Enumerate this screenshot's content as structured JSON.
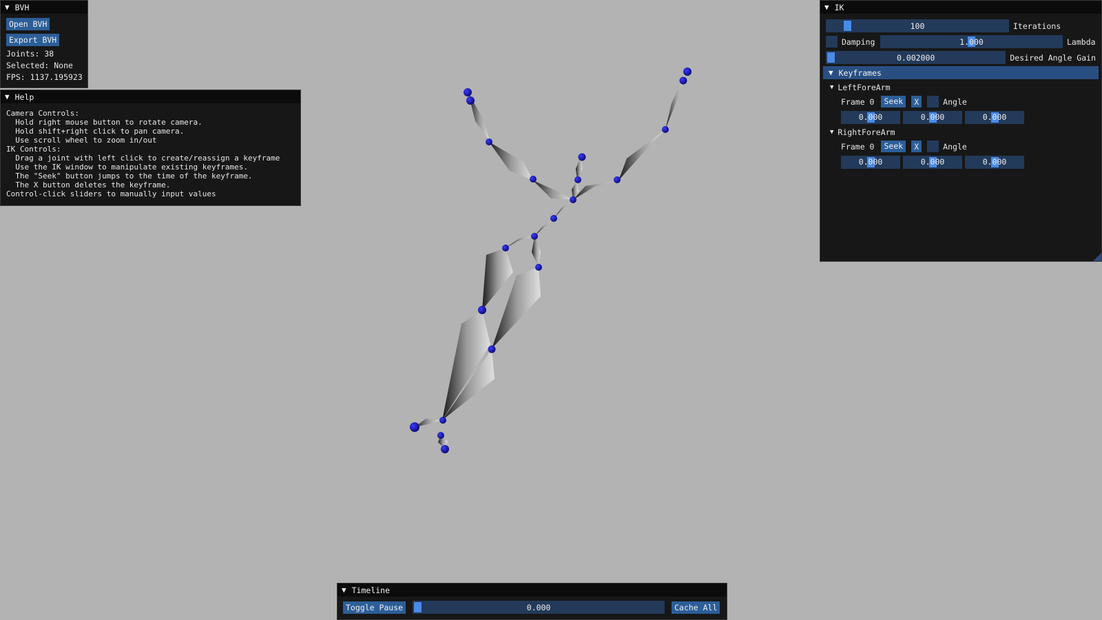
{
  "bvh_window": {
    "title": "BVH",
    "open_label": "Open BVH",
    "export_label": "Export BVH",
    "joints": "Joints: 38",
    "selected": "Selected: None",
    "fps": "FPS: 1137.195923"
  },
  "help_window": {
    "title": "Help",
    "lines": [
      "Camera Controls:",
      "  Hold right mouse button to rotate camera.",
      "  Hold shift+right click to pan camera.",
      "  Use scroll wheel to zoom in/out",
      "IK Controls:",
      "  Drag a joint with left click to create/reassign a keyframe",
      "  Use the IK window to manipulate existing keyframes.",
      "  The \"Seek\" button jumps to the time of the keyframe.",
      "  The X button deletes the keyframe.",
      "Control-click sliders to manually input values"
    ]
  },
  "ik_window": {
    "title": "IK",
    "iterations": {
      "value": "100",
      "label": "Iterations",
      "fraction": 0.1
    },
    "damping_label": "Damping",
    "lambda": {
      "value": "1.000",
      "label": "Lambda",
      "fraction": 0.5
    },
    "gain": {
      "value": "0.002000",
      "label": "Desired Angle Gain",
      "fraction": 0.0
    },
    "keyframes_header": "Keyframes",
    "keyframes": [
      {
        "joint": "LeftForeArm",
        "frame_label": "Frame 0",
        "seek_label": "Seek",
        "x_label": "X",
        "angle_label": "Angle",
        "values": [
          "0.000",
          "0.000",
          "0.000"
        ]
      },
      {
        "joint": "RightForeArm",
        "frame_label": "Frame 0",
        "seek_label": "Seek",
        "x_label": "X",
        "angle_label": "Angle",
        "values": [
          "0.000",
          "0.000",
          "0.000"
        ]
      }
    ]
  },
  "timeline_window": {
    "title": "Timeline",
    "toggle_label": "Toggle Pause",
    "time_value": "0.000",
    "cache_label": "Cache All"
  },
  "colors": {
    "background": "#b3b3b3",
    "window_bg": "#111111",
    "button": "#2c5e98",
    "slider_bg": "#233a5a",
    "slider_grab": "#4a8ae8",
    "joint": "#1c1cb0"
  }
}
